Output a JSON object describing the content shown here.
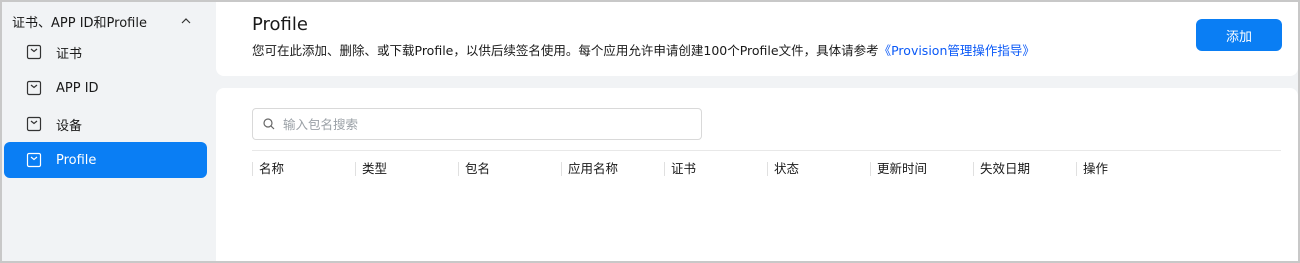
{
  "sidebar": {
    "group_title": "证书、APP ID和Profile",
    "items": [
      {
        "label": "证书",
        "active": false
      },
      {
        "label": "APP ID",
        "active": false
      },
      {
        "label": "设备",
        "active": false
      },
      {
        "label": "Profile",
        "active": true
      }
    ]
  },
  "header": {
    "title": "Profile",
    "description": "您可在此添加、删除、或下载Profile，以供后续签名使用。每个应用允许申请创建100个Profile文件，具体请参考",
    "link_text": "《Provision管理操作指导》",
    "add_button": "添加"
  },
  "search": {
    "placeholder": "输入包名搜索"
  },
  "table": {
    "columns": [
      "名称",
      "类型",
      "包名",
      "应用名称",
      "证书",
      "状态",
      "更新时间",
      "失效日期",
      "操作"
    ]
  },
  "colors": {
    "accent": "#0a7ef4",
    "link": "#0a59f7",
    "background": "#f1f3f5"
  }
}
